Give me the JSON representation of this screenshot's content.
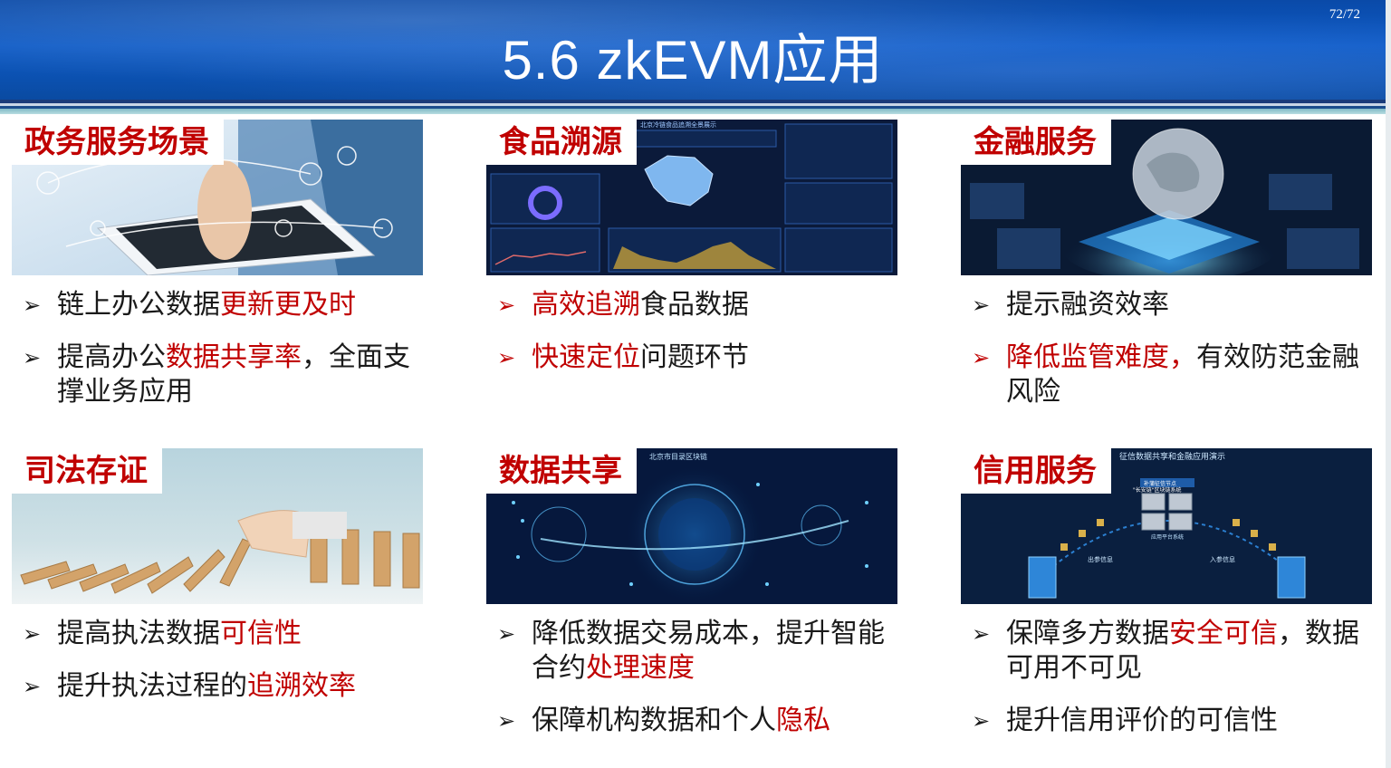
{
  "header": {
    "title": "5.6 zkEVM应用",
    "page_number": "72/72"
  },
  "cards": [
    {
      "label": "政务服务场景",
      "bullets": [
        {
          "arrow_red": false,
          "parts": [
            {
              "text": "链上办公数据",
              "hl": false
            },
            {
              "text": "更新更及时",
              "hl": true
            }
          ]
        },
        {
          "arrow_red": false,
          "parts": [
            {
              "text": "提高办公",
              "hl": false
            },
            {
              "text": "数据共享率",
              "hl": true
            },
            {
              "text": "，全面支撑业务应用",
              "hl": false
            }
          ]
        }
      ]
    },
    {
      "label": "食品溯源",
      "bullets": [
        {
          "arrow_red": true,
          "parts": [
            {
              "text": "高效追溯",
              "hl": true
            },
            {
              "text": "食品数据",
              "hl": false
            }
          ]
        },
        {
          "arrow_red": true,
          "parts": [
            {
              "text": "快速定位",
              "hl": true
            },
            {
              "text": "问题环节",
              "hl": false
            }
          ]
        }
      ]
    },
    {
      "label": "金融服务",
      "bullets": [
        {
          "arrow_red": false,
          "parts": [
            {
              "text": "提示融资效率",
              "hl": false
            }
          ]
        },
        {
          "arrow_red": true,
          "parts": [
            {
              "text": "降低监管难度，",
              "hl": true
            },
            {
              "text": "有效防范金融风险",
              "hl": false
            }
          ]
        }
      ]
    },
    {
      "label": "司法存证",
      "bullets": [
        {
          "arrow_red": false,
          "parts": [
            {
              "text": "提高执法数据",
              "hl": false
            },
            {
              "text": "可信性",
              "hl": true
            }
          ]
        },
        {
          "arrow_red": false,
          "parts": [
            {
              "text": "提升执法过程的",
              "hl": false
            },
            {
              "text": "追溯效率",
              "hl": true
            }
          ]
        }
      ]
    },
    {
      "label": "数据共享",
      "bullets": [
        {
          "arrow_red": false,
          "parts": [
            {
              "text": "降低数据交易成本，提升智能合约",
              "hl": false
            },
            {
              "text": "处理速度",
              "hl": true
            }
          ]
        },
        {
          "arrow_red": false,
          "parts": [
            {
              "text": "保障机构数据和个人",
              "hl": false
            },
            {
              "text": "隐私",
              "hl": true
            }
          ]
        }
      ]
    },
    {
      "label": "信用服务",
      "bullets": [
        {
          "arrow_red": false,
          "parts": [
            {
              "text": "保障多方数据",
              "hl": false
            },
            {
              "text": "安全可信",
              "hl": true
            },
            {
              "text": "，数据可用不可见",
              "hl": false
            }
          ]
        },
        {
          "arrow_red": false,
          "parts": [
            {
              "text": "提升信用评价的可信性",
              "hl": false
            }
          ]
        }
      ]
    }
  ],
  "images": {
    "food_dashboard_title": "北京冷链食品追溯全景展示",
    "data_share_title": "北京市目录区块链",
    "credit_title": "征信数据共享和金融应用演示",
    "credit_node": "补蒲征信节点",
    "credit_chain": "\"长安链\"区块链系统",
    "credit_platform": "应用平台系统",
    "credit_out": "出参信息",
    "credit_in": "入参信息"
  },
  "colors": {
    "header_blue": "#0d5ac6",
    "highlight_red": "#c00000",
    "text": "#1a1a1a"
  }
}
